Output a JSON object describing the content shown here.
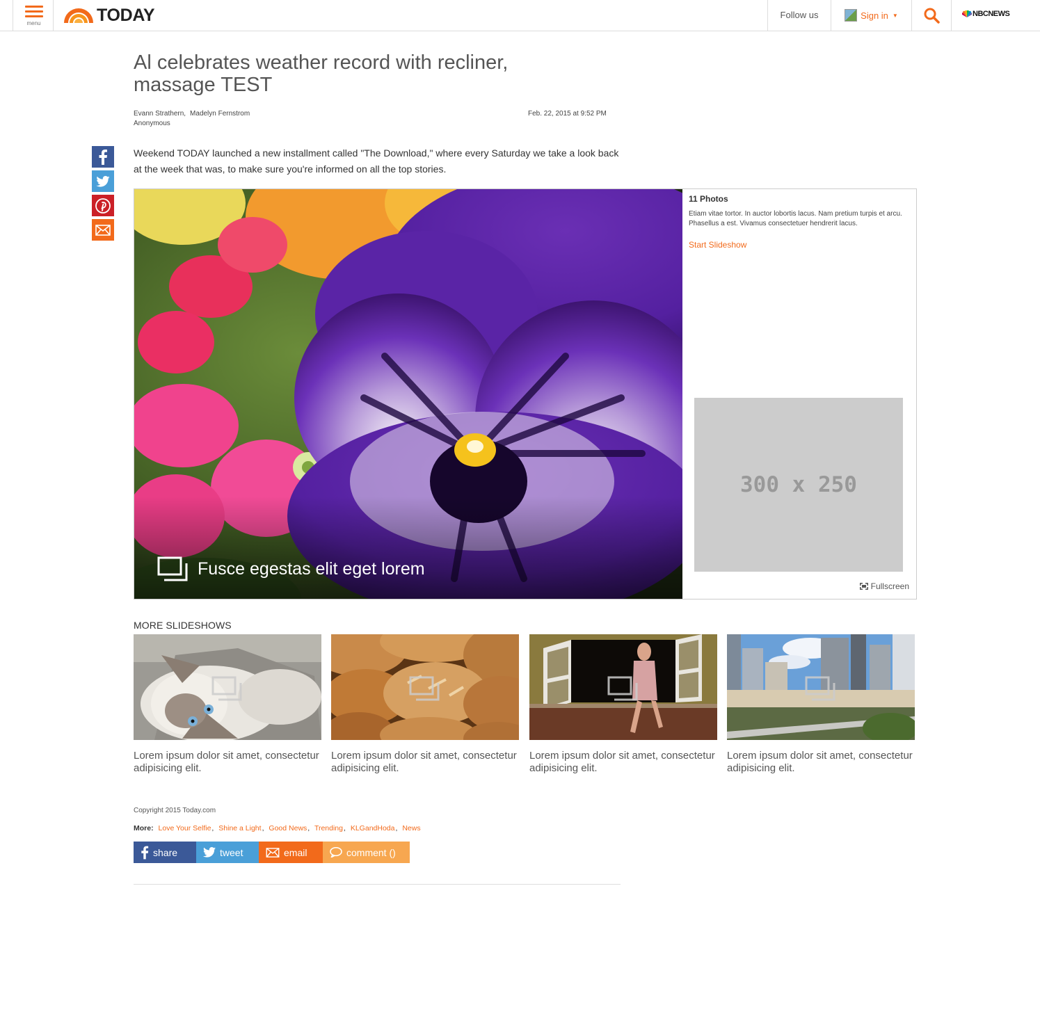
{
  "header": {
    "menu_label": "menu",
    "logo_text": "TODAY",
    "follow_label": "Follow us",
    "signin_label": "Sign in",
    "network_label": "NBCNEWS",
    "brand_color": "#f26a1b"
  },
  "article": {
    "title": "Al celebrates weather record with recliner, massage TEST",
    "authors": [
      "Evann Strathern,",
      "Madelyn Fernstrom"
    ],
    "author_line2": "Anonymous",
    "date": "Feb. 22, 2015 at 9:52 PM",
    "intro": "Weekend TODAY launched a new installment called \"The Download,\" where every Saturday we take a look back at the week that was, to make sure you're informed on all the top stories."
  },
  "social": [
    "facebook-icon",
    "twitter-icon",
    "pinterest-icon",
    "email-icon"
  ],
  "slideshow": {
    "caption": "Fusce egestas elit eget lorem",
    "photo_count": "11 Photos",
    "description": "Etiam vitae tortor. In auctor lobortis lacus. Nam pretium turpis et arcu. Phasellus a est. Vivamus consectetuer hendrerit lacus.",
    "start_label": "Start Slideshow",
    "ad_label": "300 x 250",
    "fullscreen_label": "Fullscreen"
  },
  "more_slideshows": {
    "heading": "MORE SLIDESHOWS",
    "items": [
      {
        "caption": "Lorem ipsum dolor sit amet, consectetur adipisicing elit.",
        "image": "cat"
      },
      {
        "caption": "Lorem ipsum dolor sit amet, consectetur adipisicing elit.",
        "image": "bread"
      },
      {
        "caption": "Lorem ipsum dolor sit amet, consectetur adipisicing elit.",
        "image": "woman-window"
      },
      {
        "caption": "Lorem ipsum dolor sit amet, consectetur adipisicing elit.",
        "image": "city"
      }
    ]
  },
  "footer": {
    "copyright": "Copyright 2015 Today.com",
    "more_label": "More:",
    "links": [
      "Love Your Selfie",
      "Shine a Light",
      "Good News",
      "Trending",
      "KLGandHoda",
      "News"
    ],
    "share_label": "share",
    "tweet_label": "tweet",
    "email_label": "email",
    "comment_label": "comment ()"
  }
}
